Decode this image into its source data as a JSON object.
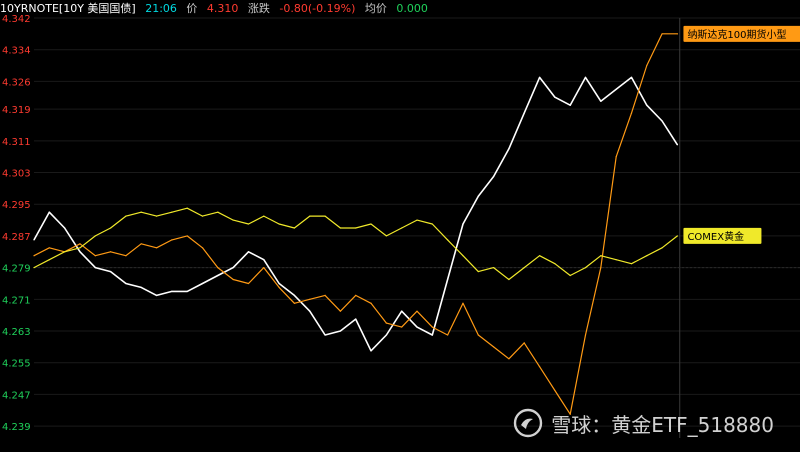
{
  "header": {
    "symbol": "10YRNOTE[10Y 美国国债]",
    "time": "21:06",
    "price_label": "价",
    "price": "4.310",
    "change_label": "涨跌",
    "change": "-0.80(-0.19%)",
    "avg_label": "均价",
    "avg": "0.000"
  },
  "watermark": {
    "text": "雪球：黄金ETF_518880"
  },
  "colors": {
    "background": "#000000",
    "up": "#ff3b30",
    "down": "#1fd05a",
    "treasury": "#ffffff",
    "nasdaq": "#ff9a14",
    "gold": "#f0e92a"
  },
  "chart_data": {
    "type": "line",
    "y_ticks": [
      "4.342",
      "4.334",
      "4.326",
      "4.319",
      "4.311",
      "4.303",
      "4.295",
      "4.287",
      "4.279",
      "4.271",
      "4.263",
      "4.255",
      "4.247",
      "4.239"
    ],
    "y_tick_colors": [
      "up",
      "up",
      "up",
      "up",
      "up",
      "up",
      "up",
      "up",
      "down",
      "down",
      "down",
      "down",
      "down",
      "down"
    ],
    "ylim": [
      4.236,
      4.342
    ],
    "xlim": [
      0,
      100
    ],
    "reference_line": 4.279,
    "series": [
      {
        "name": "",
        "color_key": "treasury",
        "x": [
          0,
          2,
          4,
          6,
          8,
          10,
          12,
          14,
          16,
          18,
          20,
          22,
          24,
          26,
          28,
          30,
          32,
          34,
          36,
          38,
          40,
          42,
          44,
          46,
          48,
          50,
          52,
          54,
          56,
          58,
          60,
          62,
          64,
          66,
          68,
          70,
          72,
          74,
          76,
          78,
          80,
          82,
          84
        ],
        "values": [
          4.286,
          4.293,
          4.289,
          4.283,
          4.279,
          4.278,
          4.275,
          4.274,
          4.272,
          4.273,
          4.273,
          4.275,
          4.277,
          4.279,
          4.283,
          4.281,
          4.275,
          4.272,
          4.268,
          4.262,
          4.263,
          4.266,
          4.258,
          4.262,
          4.268,
          4.264,
          4.262,
          4.276,
          4.29,
          4.297,
          4.302,
          4.309,
          4.318,
          4.327,
          4.322,
          4.32,
          4.327,
          4.321,
          4.324,
          4.327,
          4.32,
          4.316,
          4.31
        ]
      },
      {
        "name": "纳斯达克100期货小型",
        "color_key": "nasdaq",
        "x": [
          0,
          2,
          4,
          6,
          8,
          10,
          12,
          14,
          16,
          18,
          20,
          22,
          24,
          26,
          28,
          30,
          32,
          34,
          36,
          38,
          40,
          42,
          44,
          46,
          48,
          50,
          52,
          54,
          56,
          58,
          60,
          62,
          64,
          66,
          68,
          70,
          72,
          74,
          76,
          78,
          80,
          82,
          84
        ],
        "values": [
          4.282,
          4.284,
          4.283,
          4.285,
          4.282,
          4.283,
          4.282,
          4.285,
          4.284,
          4.286,
          4.287,
          4.284,
          4.279,
          4.276,
          4.275,
          4.279,
          4.274,
          4.27,
          4.271,
          4.272,
          4.268,
          4.272,
          4.27,
          4.265,
          4.264,
          4.268,
          4.264,
          4.262,
          4.27,
          4.262,
          4.259,
          4.256,
          4.26,
          4.254,
          4.248,
          4.242,
          4.262,
          4.279,
          4.307,
          4.318,
          4.33,
          4.338,
          4.338
        ]
      },
      {
        "name": "COMEX黄金",
        "color_key": "gold",
        "x": [
          0,
          2,
          4,
          6,
          8,
          10,
          12,
          14,
          16,
          18,
          20,
          22,
          24,
          26,
          28,
          30,
          32,
          34,
          36,
          38,
          40,
          42,
          44,
          46,
          48,
          50,
          52,
          54,
          56,
          58,
          60,
          62,
          64,
          66,
          68,
          70,
          72,
          74,
          76,
          78,
          80,
          82,
          84
        ],
        "values": [
          4.279,
          4.281,
          4.283,
          4.284,
          4.287,
          4.289,
          4.292,
          4.293,
          4.292,
          4.293,
          4.294,
          4.292,
          4.293,
          4.291,
          4.29,
          4.292,
          4.29,
          4.289,
          4.292,
          4.292,
          4.289,
          4.289,
          4.29,
          4.287,
          4.289,
          4.291,
          4.29,
          4.286,
          4.282,
          4.278,
          4.279,
          4.276,
          4.279,
          4.282,
          4.28,
          4.277,
          4.279,
          4.282,
          4.281,
          4.28,
          4.282,
          4.284,
          4.287
        ]
      }
    ]
  }
}
